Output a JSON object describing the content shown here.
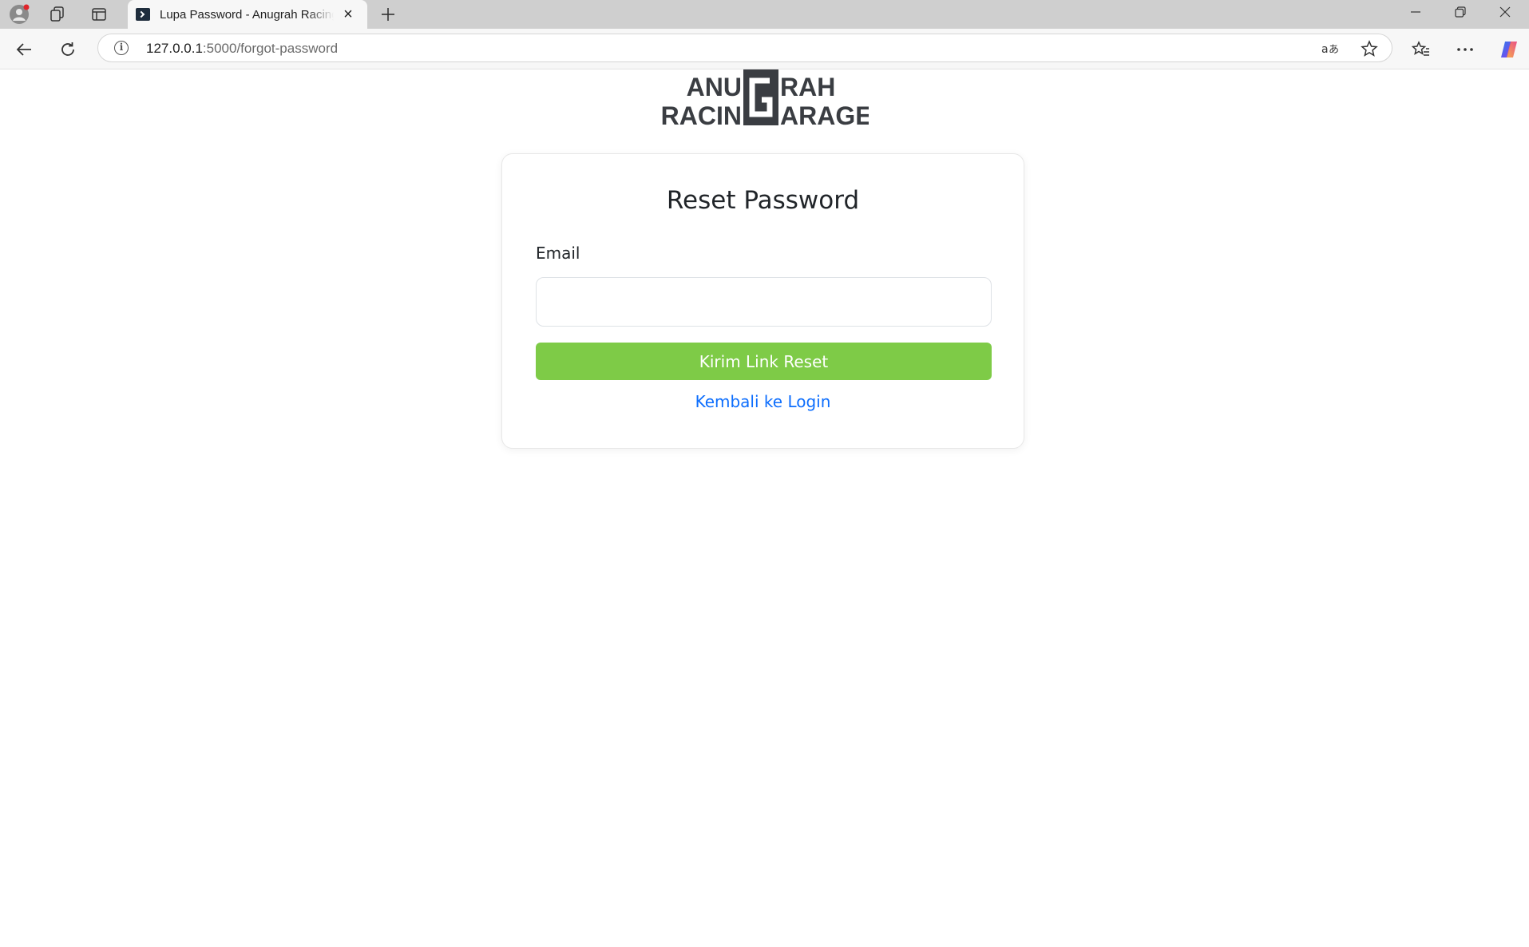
{
  "browser": {
    "tab": {
      "title": "Lupa Password - Anugrah Racing Garage"
    },
    "address_bar": {
      "host": "127.0.0.1",
      "rest": ":5000/forgot-password"
    }
  },
  "logo": {
    "line1_left": "ANU",
    "line1_right": "RAH",
    "line2_left": "RACIN",
    "line2_right": "ARAGE",
    "center_letter": "G"
  },
  "form": {
    "title": "Reset Password",
    "email_label": "Email",
    "email_value": "",
    "submit_label": "Kirim Link Reset",
    "back_link_label": "Kembali ke Login"
  },
  "colors": {
    "button": "#7ecb47",
    "link": "#0d6efd",
    "logo": "#3a3d42"
  }
}
